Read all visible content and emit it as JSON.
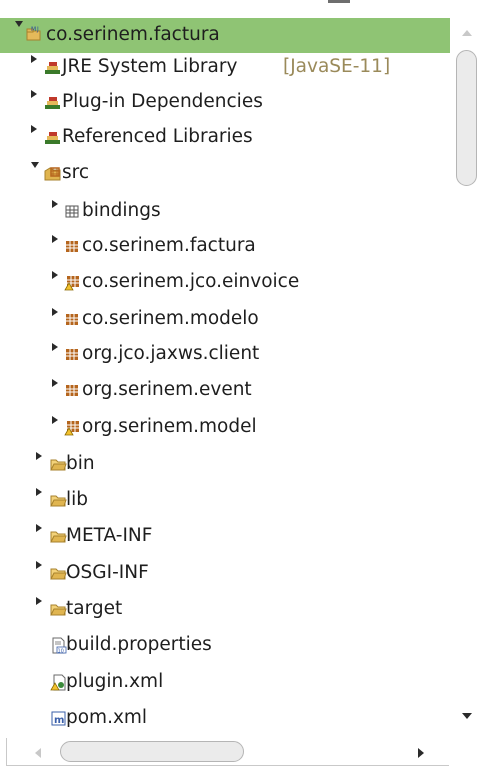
{
  "tree": {
    "project": {
      "label": "co.serinem.factura"
    },
    "jre": {
      "label": "JRE System Library",
      "decoration": "[JavaSE-11]"
    },
    "plugin_deps": {
      "label": "Plug-in Dependencies"
    },
    "ref_libs": {
      "label": "Referenced Libraries"
    },
    "src": {
      "label": "src"
    },
    "packages": [
      {
        "label": "bindings",
        "icon": "package-empty-icon"
      },
      {
        "label": "co.serinem.factura",
        "icon": "package-icon"
      },
      {
        "label": "co.serinem.jco.einvoice",
        "icon": "package-warning-icon"
      },
      {
        "label": "co.serinem.modelo",
        "icon": "package-icon"
      },
      {
        "label": "org.jco.jaxws.client",
        "icon": "package-icon"
      },
      {
        "label": "org.serinem.event",
        "icon": "package-icon"
      },
      {
        "label": "org.serinem.model",
        "icon": "package-warning-icon"
      }
    ],
    "folders": [
      {
        "label": "bin"
      },
      {
        "label": "lib"
      },
      {
        "label": "META-INF"
      },
      {
        "label": "OSGI-INF"
      },
      {
        "label": "target"
      }
    ],
    "files": [
      {
        "label": "build.properties",
        "icon": "properties-file-icon"
      },
      {
        "label": "plugin.xml",
        "icon": "plugin-xml-icon"
      },
      {
        "label": "pom.xml",
        "icon": "maven-pom-icon"
      }
    ]
  },
  "colors": {
    "selection": "#8fc474",
    "package": "#b5651d",
    "folder": "#e0b550",
    "library": "#3a7a2a"
  }
}
